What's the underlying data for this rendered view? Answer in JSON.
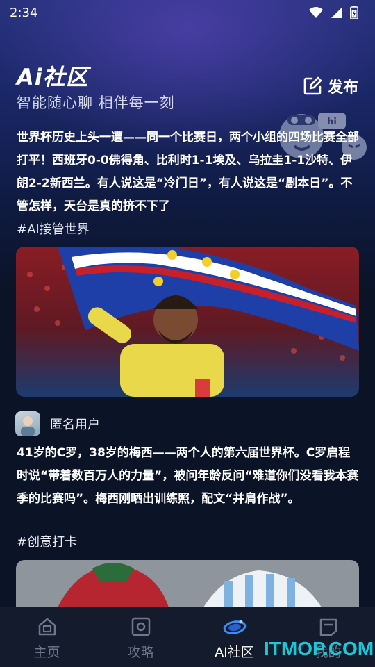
{
  "status": {
    "time": "2:34"
  },
  "header": {
    "logo": "Ai社区",
    "subtitle": "智能随心聊 相伴每一刻",
    "publish_label": "发布"
  },
  "posts": [
    {
      "text": "世界杯历史上头一遭——同一个比赛日，两个小组的四场比赛全部打平！西班牙0-0佛得角、比利时1-1埃及、乌拉圭1-1沙特、伊朗2-2新西兰。有人说这是“冷门日”，有人说这是“剧本日”。不管怎样，天台是真的挤不下了",
      "tag": "#AI接管世界"
    },
    {
      "user": "匿名用户",
      "text": "41岁的C罗，38岁的梅西——两个人的第六届世界杯。C罗启程时说“带着数百万人的力量”，被问年龄反问“难道你们没看我本赛季的比赛吗”。梅西刚晒出训练照，配文“并肩作战”。",
      "tag": "#创意打卡"
    }
  ],
  "tabs": [
    {
      "label": "主页",
      "icon": "home-icon",
      "active": false
    },
    {
      "label": "攻略",
      "icon": "guide-icon",
      "active": false
    },
    {
      "label": "AI社区",
      "icon": "ai-community-icon",
      "active": true
    },
    {
      "label": "我的",
      "icon": "profile-icon",
      "active": false
    }
  ],
  "watermark": "ITMOP.COM",
  "colors": {
    "accent": "#19c8d9",
    "tab_inactive": "#6f778a",
    "background": "#0b1326"
  }
}
